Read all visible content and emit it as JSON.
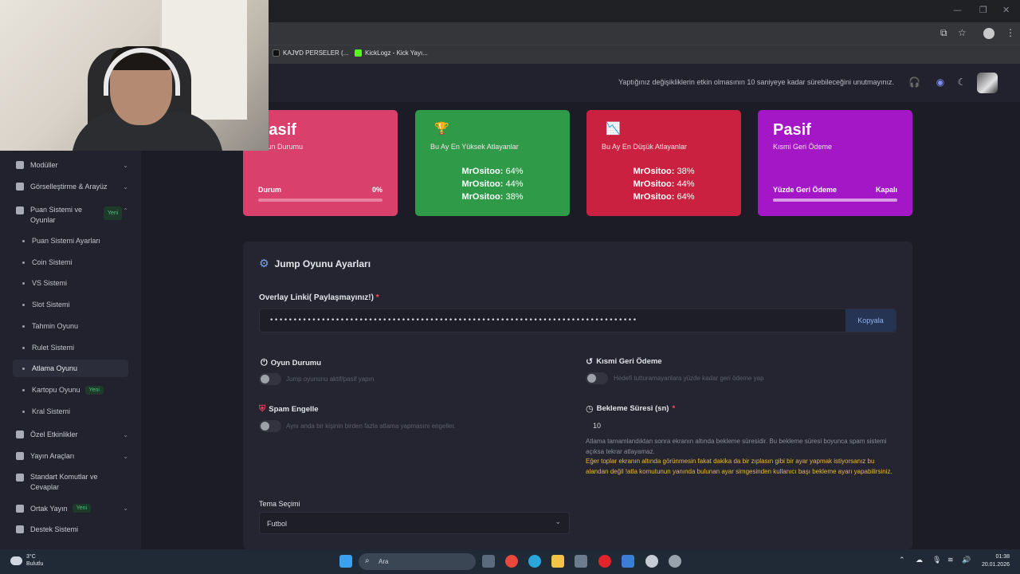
{
  "browser": {
    "bookmarks": [
      {
        "label": "KAJ∀D PERSELER (...",
        "color": "#111111"
      },
      {
        "label": "KickLogz - Kick Yayı...",
        "color": "#53fc18"
      }
    ]
  },
  "header": {
    "notice": "Yaptığınız değişikliklerin etkin olmasının 10 saniyeye kadar sürebileceğini unutmayınız."
  },
  "sidebar": {
    "items": [
      {
        "label": "Modüller",
        "icon": "grid-icon"
      },
      {
        "label": "Görselleştirme & Arayüz",
        "icon": "calendar-icon"
      },
      {
        "label": "Puan Sistemi ve",
        "label2": "Oyunlar",
        "badge": "Yeni",
        "icon": "database-icon"
      }
    ],
    "sub_items": [
      {
        "label": "Puan Sistemi Ayarları"
      },
      {
        "label": "Coin Sistemi"
      },
      {
        "label": "VS Sistemi"
      },
      {
        "label": "Slot Sistemi"
      },
      {
        "label": "Tahmin Oyunu"
      },
      {
        "label": "Rulet Sistemi"
      },
      {
        "label": "Atlama Oyunu"
      },
      {
        "label": "Kartopu Oyunu",
        "badge": "Yeni"
      },
      {
        "label": "Kral Sistemi"
      }
    ],
    "bottom_items": [
      {
        "label": "Özel Etkinlikler",
        "icon": "calendar-icon"
      },
      {
        "label": "Yayın Araçları",
        "icon": "tools-icon"
      },
      {
        "label": "Standart Komutlar ve",
        "label2": "Cevaplar",
        "icon": "keyboard-icon"
      },
      {
        "label": "Ortak Yayın",
        "badge": "Yeni",
        "icon": "users-icon"
      },
      {
        "label": "Destek Sistemi",
        "icon": "support-icon"
      }
    ]
  },
  "cards": [
    {
      "big": "Pasif",
      "sub": "Oyun Durumu",
      "prog_label": "Durum",
      "prog_value": "0%",
      "progress": 0,
      "color": "#d9406c"
    },
    {
      "title": "Bu Ay En Yüksek Atlayanlar",
      "lines": [
        {
          "name": "MrOsitoo:",
          "val": "64%"
        },
        {
          "name": "MrOsitoo:",
          "val": "44%"
        },
        {
          "name": "MrOsitoo:",
          "val": "38%"
        }
      ],
      "color": "#2f9a48"
    },
    {
      "title": "Bu Ay En Düşük Atlayanlar",
      "lines": [
        {
          "name": "MrOsitoo:",
          "val": "38%"
        },
        {
          "name": "MrOsitoo:",
          "val": "44%"
        },
        {
          "name": "MrOsitoo:",
          "val": "64%"
        }
      ],
      "color": "#c9213f"
    },
    {
      "big": "Pasif",
      "sub": "Kısmi Geri Ödeme",
      "prog_label": "Yüzde Geri Ödeme",
      "prog_value": "Kapalı",
      "progress": 1,
      "color": "#a417c7"
    }
  ],
  "panel": {
    "title": "Jump Oyunu Ayarları",
    "overlay_label": "Overlay Linki( Paylaşmayınız!)",
    "overlay_value": "••••••••••••••••••••••••••••••••••••••••••••••••••••••••••••••••••••••••••••••",
    "copy_label": "Kopyala",
    "oyun_durumu": "Oyun Durumu",
    "oyun_durumu_hint": "Jump oyununu aktif/pasif yapın",
    "kismi": "Kısmi Geri Ödeme",
    "kismi_hint": "Hedefi tutturamayanlara yüzde kadar geri ödeme yap",
    "spam": "Spam Engelle",
    "spam_hint": "Aynı anda bir kişinin birden fazla atlama yapmasını engeller.",
    "bekleme": "Bekleme Süresi (sn)",
    "bekleme_value": "10",
    "bekleme_desc": "Atlama tamamlandıktan sonra ekranın altında bekleme süresidir. Bu bekleme süresi boyunca spam sistemi açıksa tekrar atlayamaz.",
    "bekleme_warn": "Eğer toplar ekranın altında görünmesin fakat dakika da bir zıplasın gibi bir ayar yapmak istiyorsanız bu alandan değil !atla komutunun yanında bulunan ayar simgesinden kullanıcı başı bekleme ayarı yapabilirsiniz.",
    "tema_label": "Tema Seçimi",
    "tema_value": "Futbol"
  },
  "taskbar": {
    "temp": "3°C",
    "weather": "Bulutlu",
    "search": "Ara",
    "time": "01:38",
    "date": "20.01.2026"
  }
}
